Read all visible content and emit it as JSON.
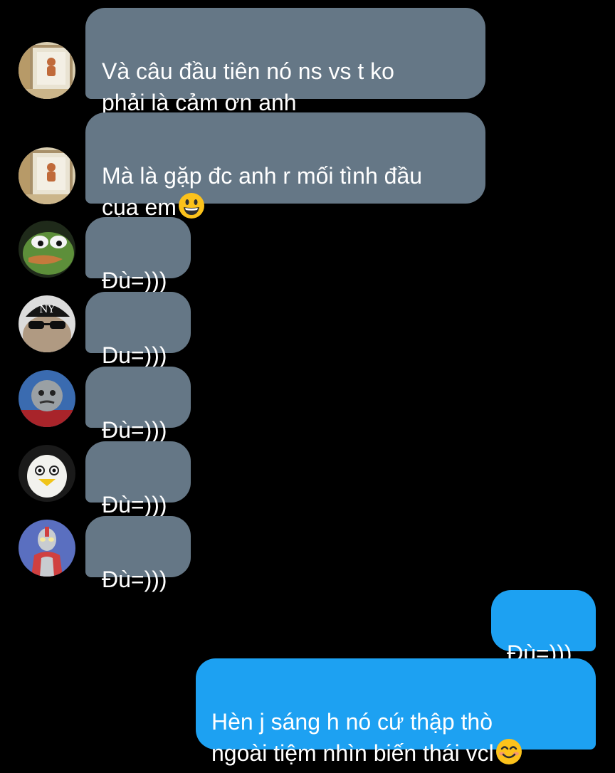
{
  "incoming": [
    {
      "text": "Và câu đầu tiên nó ns vs t ko\nphải là cảm ơn anh",
      "avatar": "window-figurine-avatar"
    },
    {
      "text": "Mà là gặp đc anh r mối tình đầu\ncụa em",
      "emoji": "grinning-face-emoji",
      "avatar": "window-figurine-avatar"
    },
    {
      "text": "Đù=)))",
      "avatar": "pepe-frog-avatar"
    },
    {
      "text": "Du=)))",
      "avatar": "cat-cap-sunglasses-avatar"
    },
    {
      "text": "Đù=)))",
      "avatar": "thomas-engine-avatar"
    },
    {
      "text": "Đù=)))",
      "avatar": "pengsoo-penguin-avatar"
    },
    {
      "text": "Đù=)))",
      "avatar": "ultraman-avatar"
    }
  ],
  "outgoing": [
    {
      "text": "Đù=)))"
    },
    {
      "text": "Hèn j sáng h nó cứ thập thò\nngoài tiệm nhìn biến thái vcl",
      "emoji": "smiling-face-emoji"
    }
  ],
  "colors": {
    "background": "#000000",
    "incoming_bubble": "#657786",
    "outgoing_bubble": "#1da1f2",
    "text": "#ffffff"
  }
}
